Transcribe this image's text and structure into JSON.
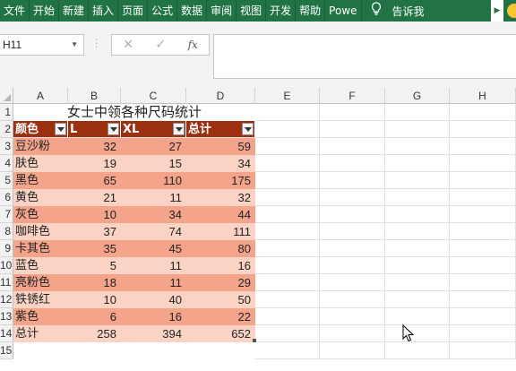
{
  "ribbon": {
    "tabs": [
      "文件",
      "开始",
      "新建",
      "插入",
      "页面",
      "公式",
      "数据",
      "审阅",
      "视图",
      "开发",
      "帮助",
      "Powe"
    ],
    "tell_me": "告诉我",
    "accent": "#217346"
  },
  "formula_bar": {
    "name_box": "H11",
    "cancel_icon": "✕",
    "enter_icon": "✓",
    "fx_label": "fx",
    "formula_value": ""
  },
  "columns": [
    "A",
    "B",
    "C",
    "D",
    "E",
    "F",
    "G",
    "H"
  ],
  "rows": [
    "1",
    "2",
    "3",
    "4",
    "5",
    "6",
    "7",
    "8",
    "9",
    "10",
    "11",
    "12",
    "13",
    "14",
    "15"
  ],
  "sheet": {
    "title": "女士中领各种尺码统计",
    "headers": [
      "颜色",
      "L",
      "XL",
      "总计"
    ],
    "header_color": "#9c2f10",
    "band_dark": "#f4a48b",
    "band_light": "#fbd3c5",
    "data": [
      {
        "color": "豆沙粉",
        "l": "32",
        "xl": "27",
        "total": "59"
      },
      {
        "color": "肤色",
        "l": "19",
        "xl": "15",
        "total": "34"
      },
      {
        "color": "黑色",
        "l": "65",
        "xl": "110",
        "total": "175"
      },
      {
        "color": "黄色",
        "l": "21",
        "xl": "11",
        "total": "32"
      },
      {
        "color": "灰色",
        "l": "10",
        "xl": "34",
        "total": "44"
      },
      {
        "color": "咖啡色",
        "l": "37",
        "xl": "74",
        "total": "111"
      },
      {
        "color": "卡其色",
        "l": "35",
        "xl": "45",
        "total": "80"
      },
      {
        "color": "蓝色",
        "l": "5",
        "xl": "11",
        "total": "16"
      },
      {
        "color": "亮粉色",
        "l": "18",
        "xl": "11",
        "total": "29"
      },
      {
        "color": "铁锈红",
        "l": "10",
        "xl": "40",
        "total": "50"
      },
      {
        "color": "紫色",
        "l": "6",
        "xl": "16",
        "total": "22"
      }
    ],
    "totals": {
      "label": "总计",
      "l": "258",
      "xl": "394",
      "total": "652"
    }
  }
}
